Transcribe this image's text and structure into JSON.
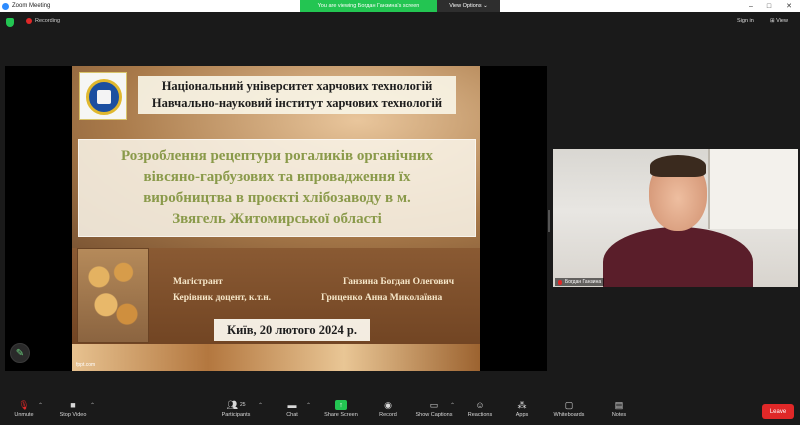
{
  "titlebar": {
    "app_name": "Zoom Meeting"
  },
  "banner": {
    "viewing_text": "You are viewing Богдан Ганзина's screen",
    "view_options": "View Options"
  },
  "topbar": {
    "recording_label": "Recording",
    "sign_in": "Sign in",
    "view": "View"
  },
  "slide": {
    "university_line1": "Національний університет харчових технологій",
    "university_line2": "Навчально-науковий інститут харчових технологій",
    "topic_line1": "Розроблення рецептури рогаликів органічних",
    "topic_line2": "вівсяно-гарбузових та впровадження їх",
    "topic_line3": "виробництва в проєкті  хлібозаводу в м.",
    "topic_line4": "Звягель Житомирської області",
    "role_student": "Магістрант",
    "name_student": "Ганзина Богдан Олегович",
    "role_supervisor": "Керівник доцент, к.т.н.",
    "name_supervisor": "Гриценко Анна Миколаївна",
    "date": "Київ, 20 лютого 2024 р.",
    "footnote": "fppt.com"
  },
  "participant": {
    "name_tag": "Богдан Ганзина"
  },
  "toolbar": {
    "unmute": "Unmute",
    "stop_video": "Stop Video",
    "participants": "Participants",
    "participants_count": "25",
    "chat": "Chat",
    "share_screen": "Share Screen",
    "record": "Record",
    "show_captions": "Show Captions",
    "reactions": "Reactions",
    "apps": "Apps",
    "whiteboards": "Whiteboards",
    "notes": "Notes",
    "leave": "Leave"
  },
  "colors": {
    "accent_green": "#23c552",
    "leave_red": "#e02828",
    "topic_text": "#8a9a4a"
  }
}
